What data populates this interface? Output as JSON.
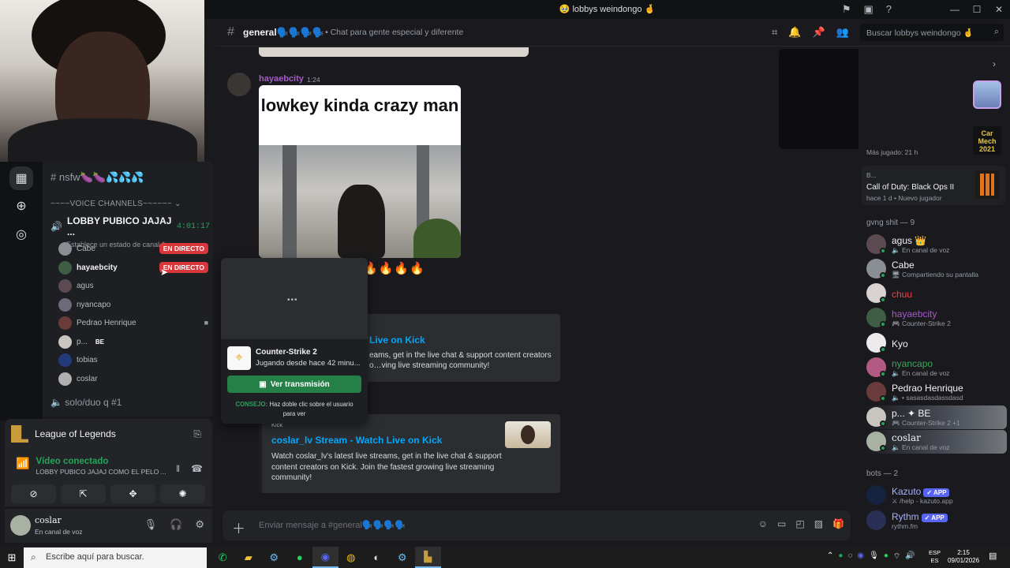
{
  "window": {
    "title": "🥹 lobbys weindongo 🤞"
  },
  "sidebar": {
    "text_channel": "# nsfw🍆🍆💦💦💦",
    "section_label": "~~~~VOICE CHANNELS~~~~~~ ⌄",
    "voice_channel": {
      "name": "LOBBY PUBICO JAJAJ ...",
      "timer": "4:01:17",
      "status_placeholder": "Establece un estado de canal ✎",
      "live_label": "EN DIRECTO",
      "users": [
        {
          "name": "Cabe",
          "live": true
        },
        {
          "name": "hayaebcity",
          "live": true
        },
        {
          "name": "agus",
          "live": false
        },
        {
          "name": "nyancapo",
          "live": false
        },
        {
          "name": "Pedrao Henrique",
          "live": false,
          "camera": true
        },
        {
          "name": "p...",
          "live": false,
          "tag": "BE"
        },
        {
          "name": "tobias",
          "live": false
        },
        {
          "name": "coslar",
          "live": false
        }
      ]
    },
    "other_channel": "solo/duo q #1"
  },
  "activity": {
    "game": "League of Legends",
    "voice_status": "Vídeo conectado",
    "voice_channel": "LOBBY PUBICO JAJAJ COMO EL PELO ..."
  },
  "user": {
    "name": "coslar",
    "status": "En canal de voz"
  },
  "header": {
    "channel": "general🗣️🗣️🗣️🗣️",
    "topic": "Chat para gente especial y diferente",
    "search_placeholder": "Buscar lobbys weindongo 🤞"
  },
  "messages": {
    "author": "hayaebcity",
    "time": "1:24",
    "meme_caption": "lowkey kinda crazy man",
    "reaction_text": "🔥🔥🔥🔥",
    "embed1": {
      "title": "Live on Kick",
      "description": "eams, get in the live chat & support content creators o…ving live streaming community!"
    },
    "embed2": {
      "provider": "Kick",
      "title": "coslar_lv Stream - Watch Live on Kick",
      "description": "Watch coslar_lv's latest live streams, get in the live chat & support content creators on Kick. Join the fastest growing live streaming community!"
    }
  },
  "composer": {
    "placeholder": "Enviar mensaje a #general🗣️🗣️🗣️🗣️"
  },
  "stream_popout": {
    "game": "Counter-Strike 2",
    "since": "Jugando desde hace 42 minu...",
    "watch_button": "Ver transmisión",
    "tip_label": "CONSEJO:",
    "tip_text": "Haz doble clic sobre el usuario para ver"
  },
  "members": {
    "played_label": "Más jugado: 21 h",
    "activity_card": {
      "who": "B...",
      "game": "Call of Duty: Black Ops II",
      "meta": "hace 1 d   •  Nuevo jugador"
    },
    "group1_label": "gvng shit — 9",
    "group1": [
      {
        "name": "agus 👑",
        "status": "🔈 En canal de voz",
        "color": "#f2f3f5"
      },
      {
        "name": "Cabe",
        "status": "🖥 Compartiendo su pantalla",
        "color": "#f2f3f5"
      },
      {
        "name": "chuu",
        "status": "",
        "color": "#f23f43"
      },
      {
        "name": "hayaebcity",
        "status": "🎮 Counter-Strike 2",
        "color": "#a35cc6"
      },
      {
        "name": "Kyo",
        "status": "",
        "color": "#f2f3f5"
      },
      {
        "name": "nyancapo",
        "status": "🔈 En canal de voz",
        "color": "#3ba55d"
      },
      {
        "name": "Pedrao Henrique",
        "status": "🔈 • sasasdasdassdasd",
        "color": "#f2f3f5"
      },
      {
        "name": "p...  ✦ BE",
        "status": "🎮 Counter-Strike 2 +1",
        "color": "#f2f3f5"
      },
      {
        "name": "coslar",
        "status": "🔈 En canal de voz",
        "color": "#f2f3f5"
      }
    ],
    "group2_label": "bots — 2",
    "bots": [
      {
        "name": "Kazuto",
        "badge": "✓ APP",
        "status": "⚔ /help - kazuto.app"
      },
      {
        "name": "Rythm",
        "badge": "✓ APP",
        "status": "rythm.fm"
      }
    ]
  },
  "taskbar": {
    "search_placeholder": "Escribe aquí para buscar.",
    "lang_line1": "ESP",
    "lang_line2": "ES",
    "time": "2:15",
    "date": "09/01/2026"
  },
  "colors": {
    "accent": "#5865f2",
    "live": "#da373c",
    "online": "#23a55a",
    "link": "#00a8fc"
  }
}
